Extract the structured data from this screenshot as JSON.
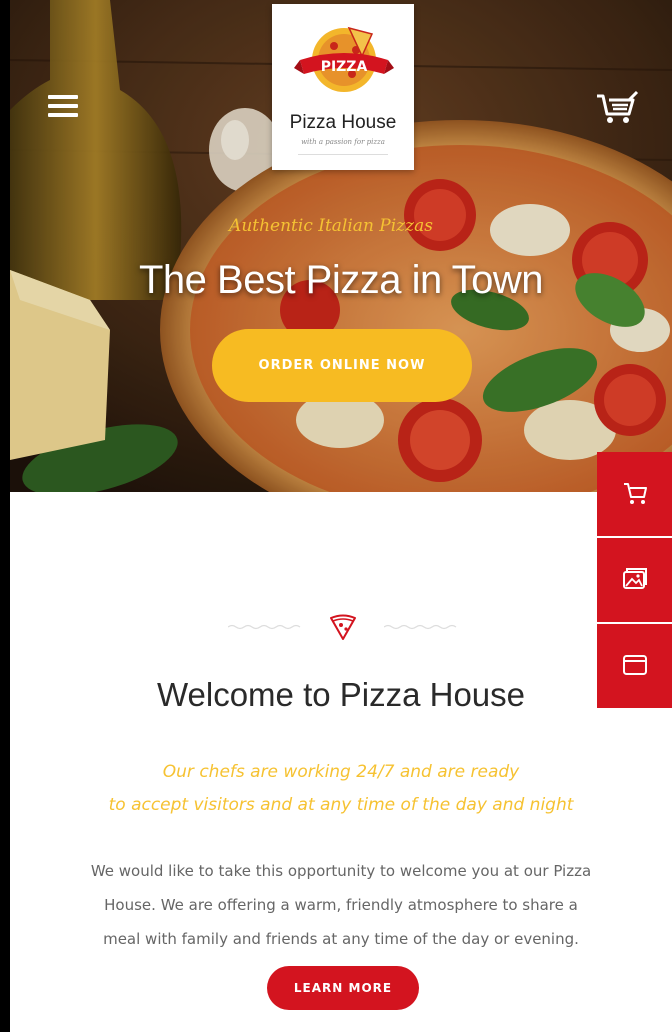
{
  "header": {
    "menu_icon": "hamburger-menu-icon",
    "cart_icon": "shopping-cart-icon",
    "logo": {
      "badge_text": "PIZZA",
      "name": "Pizza House",
      "tagline": "with a passion for pizza"
    }
  },
  "hero": {
    "kicker": "Authentic Italian Pizzas",
    "title": "The Best Pizza in Town",
    "cta_label": "ORDER ONLINE NOW"
  },
  "side_panel": {
    "items": [
      {
        "icon": "cart-icon"
      },
      {
        "icon": "gallery-icon"
      },
      {
        "icon": "browser-window-icon"
      }
    ]
  },
  "welcome": {
    "divider_icon": "pizza-slice-icon",
    "title": "Welcome to Pizza House",
    "tagline_line1": "Our chefs are working 24/7 and are ready",
    "tagline_line2": "to accept visitors and at any time of the day and night",
    "body_line1": "We would like to take this opportunity to welcome you at our Pizza",
    "body_line2": "House. We are offering a warm, friendly atmosphere to share a",
    "body_line3": "meal with family and friends at any time of the day or evening.",
    "button_label": "LEARN MORE"
  },
  "colors": {
    "brand_red": "#d3141f",
    "accent_yellow": "#f7bb22",
    "tagline_yellow": "#f6c232",
    "title_dark": "#2a2a2a",
    "body_gray": "#666666"
  }
}
